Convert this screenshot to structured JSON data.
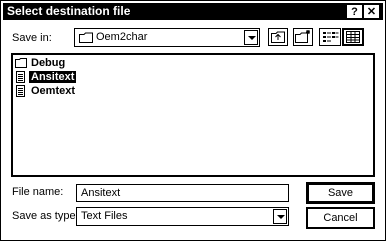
{
  "window": {
    "title": "Select destination file",
    "help_label": "?",
    "close_label": "✕"
  },
  "toolbar": {
    "savein_label": "Save in:",
    "savein_value": "Oem2char",
    "up_icon": "up-one-level-icon",
    "new_folder_icon": "new-folder-icon",
    "list_icon": "list-view-icon",
    "details_icon": "details-view-icon"
  },
  "files": [
    {
      "name": "Debug",
      "type": "folder",
      "selected": false
    },
    {
      "name": "Ansitext",
      "type": "document",
      "selected": true
    },
    {
      "name": "Oemtext",
      "type": "document",
      "selected": false
    }
  ],
  "form": {
    "filename_label": "File name:",
    "filename_value": "Ansitext",
    "savetype_label": "Save as type:",
    "savetype_value": "Text Files"
  },
  "buttons": {
    "save": "Save",
    "cancel": "Cancel"
  }
}
